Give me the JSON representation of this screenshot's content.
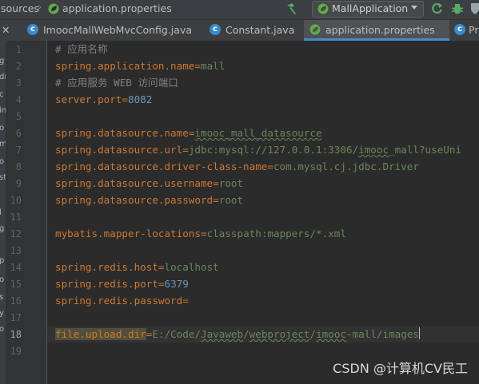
{
  "breadcrumb": {
    "items": [
      "sources",
      "application.properties"
    ]
  },
  "toolbar": {
    "run_config_label": "MallApplication"
  },
  "tabs": [
    {
      "label": "ImoocMallWebMvcConfig.java",
      "icon": "java-class-icon",
      "active": false
    },
    {
      "label": "Constant.java",
      "icon": "java-class-icon",
      "active": false
    },
    {
      "label": "application.properties",
      "icon": "spring-leaf-icon",
      "active": true
    },
    {
      "label": "Pr",
      "icon": "java-class-icon",
      "active": false
    }
  ],
  "left_strip_fragments": [
    "g",
    "dr",
    "c",
    "in",
    "o",
    "m",
    "o",
    "st",
    "l",
    "g",
    "p",
    "o",
    "s",
    "y",
    "o"
  ],
  "line_numbers": [
    "1",
    "2",
    "3",
    "4",
    "5",
    "6",
    "7",
    "8",
    "9",
    "10",
    "11",
    "12",
    "13",
    "14",
    "15",
    "16",
    "17",
    "18",
    "19"
  ],
  "current_line": "18",
  "code": {
    "line1": "# 应用名称",
    "line2_key": "spring.application.name",
    "line2_value": "mall",
    "line3": "# 应用服务 WEB 访问端口",
    "line4_key": "server.port",
    "line4_value": "8082",
    "line6_key": "spring.datasource.name",
    "line6_value": "imooc_mall_datasource",
    "line7_key": "spring.datasource.url",
    "line7_value_a": "jdbc:mysql://127.0.0.1:3306/",
    "line7_value_b": "imooc",
    "line7_value_c": "_mall?useUni",
    "line8_key": "spring.datasource.driver-class-name",
    "line8_value": "com.mysql.cj.jdbc.Driver",
    "line9_key": "spring.datasource.username",
    "line9_value": "root",
    "line10_key": "spring.datasource.password",
    "line10_value": "root",
    "line12_key": "mybatis.mapper-locations",
    "line12_value": "classpath:mappers/*.xml",
    "line14_key": "spring.redis.host",
    "line14_value": "localhost",
    "line15_key": "spring.redis.port",
    "line15_value": "6379",
    "line16_key": "spring.redis.password",
    "line18_key": "file.upload.dir",
    "line18_value_a": "E:/Code/",
    "line18_value_b": "Javaweb",
    "line18_value_c": "/",
    "line18_value_d": "webproject",
    "line18_value_e": "/",
    "line18_value_f": "imooc",
    "line18_value_g": "-mall/images"
  },
  "equals_sign": "=",
  "watermark": "CSDN @计算机CV民工",
  "colors": {
    "key": "#cc7832",
    "value": "#6a8759",
    "comment": "#808080",
    "number": "#6897bb",
    "active_tab_underline": "#4a88c7"
  }
}
